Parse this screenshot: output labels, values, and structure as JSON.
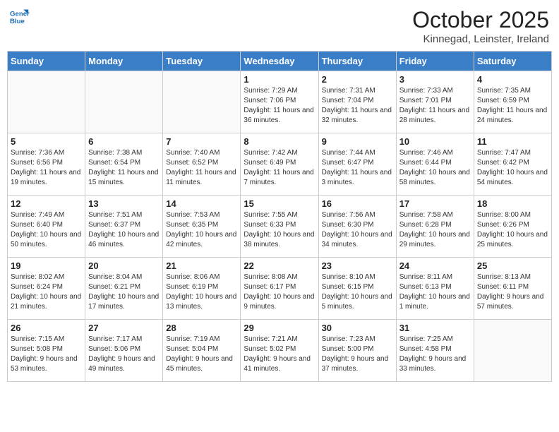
{
  "header": {
    "logo_line1": "General",
    "logo_line2": "Blue",
    "month": "October 2025",
    "location": "Kinnegad, Leinster, Ireland"
  },
  "weekdays": [
    "Sunday",
    "Monday",
    "Tuesday",
    "Wednesday",
    "Thursday",
    "Friday",
    "Saturday"
  ],
  "weeks": [
    [
      {
        "day": "",
        "content": ""
      },
      {
        "day": "",
        "content": ""
      },
      {
        "day": "",
        "content": ""
      },
      {
        "day": "1",
        "content": "Sunrise: 7:29 AM\nSunset: 7:06 PM\nDaylight: 11 hours\nand 36 minutes."
      },
      {
        "day": "2",
        "content": "Sunrise: 7:31 AM\nSunset: 7:04 PM\nDaylight: 11 hours\nand 32 minutes."
      },
      {
        "day": "3",
        "content": "Sunrise: 7:33 AM\nSunset: 7:01 PM\nDaylight: 11 hours\nand 28 minutes."
      },
      {
        "day": "4",
        "content": "Sunrise: 7:35 AM\nSunset: 6:59 PM\nDaylight: 11 hours\nand 24 minutes."
      }
    ],
    [
      {
        "day": "5",
        "content": "Sunrise: 7:36 AM\nSunset: 6:56 PM\nDaylight: 11 hours\nand 19 minutes."
      },
      {
        "day": "6",
        "content": "Sunrise: 7:38 AM\nSunset: 6:54 PM\nDaylight: 11 hours\nand 15 minutes."
      },
      {
        "day": "7",
        "content": "Sunrise: 7:40 AM\nSunset: 6:52 PM\nDaylight: 11 hours\nand 11 minutes."
      },
      {
        "day": "8",
        "content": "Sunrise: 7:42 AM\nSunset: 6:49 PM\nDaylight: 11 hours\nand 7 minutes."
      },
      {
        "day": "9",
        "content": "Sunrise: 7:44 AM\nSunset: 6:47 PM\nDaylight: 11 hours\nand 3 minutes."
      },
      {
        "day": "10",
        "content": "Sunrise: 7:46 AM\nSunset: 6:44 PM\nDaylight: 10 hours\nand 58 minutes."
      },
      {
        "day": "11",
        "content": "Sunrise: 7:47 AM\nSunset: 6:42 PM\nDaylight: 10 hours\nand 54 minutes."
      }
    ],
    [
      {
        "day": "12",
        "content": "Sunrise: 7:49 AM\nSunset: 6:40 PM\nDaylight: 10 hours\nand 50 minutes."
      },
      {
        "day": "13",
        "content": "Sunrise: 7:51 AM\nSunset: 6:37 PM\nDaylight: 10 hours\nand 46 minutes."
      },
      {
        "day": "14",
        "content": "Sunrise: 7:53 AM\nSunset: 6:35 PM\nDaylight: 10 hours\nand 42 minutes."
      },
      {
        "day": "15",
        "content": "Sunrise: 7:55 AM\nSunset: 6:33 PM\nDaylight: 10 hours\nand 38 minutes."
      },
      {
        "day": "16",
        "content": "Sunrise: 7:56 AM\nSunset: 6:30 PM\nDaylight: 10 hours\nand 34 minutes."
      },
      {
        "day": "17",
        "content": "Sunrise: 7:58 AM\nSunset: 6:28 PM\nDaylight: 10 hours\nand 29 minutes."
      },
      {
        "day": "18",
        "content": "Sunrise: 8:00 AM\nSunset: 6:26 PM\nDaylight: 10 hours\nand 25 minutes."
      }
    ],
    [
      {
        "day": "19",
        "content": "Sunrise: 8:02 AM\nSunset: 6:24 PM\nDaylight: 10 hours\nand 21 minutes."
      },
      {
        "day": "20",
        "content": "Sunrise: 8:04 AM\nSunset: 6:21 PM\nDaylight: 10 hours\nand 17 minutes."
      },
      {
        "day": "21",
        "content": "Sunrise: 8:06 AM\nSunset: 6:19 PM\nDaylight: 10 hours\nand 13 minutes."
      },
      {
        "day": "22",
        "content": "Sunrise: 8:08 AM\nSunset: 6:17 PM\nDaylight: 10 hours\nand 9 minutes."
      },
      {
        "day": "23",
        "content": "Sunrise: 8:10 AM\nSunset: 6:15 PM\nDaylight: 10 hours\nand 5 minutes."
      },
      {
        "day": "24",
        "content": "Sunrise: 8:11 AM\nSunset: 6:13 PM\nDaylight: 10 hours\nand 1 minute."
      },
      {
        "day": "25",
        "content": "Sunrise: 8:13 AM\nSunset: 6:11 PM\nDaylight: 9 hours\nand 57 minutes."
      }
    ],
    [
      {
        "day": "26",
        "content": "Sunrise: 7:15 AM\nSunset: 5:08 PM\nDaylight: 9 hours\nand 53 minutes."
      },
      {
        "day": "27",
        "content": "Sunrise: 7:17 AM\nSunset: 5:06 PM\nDaylight: 9 hours\nand 49 minutes."
      },
      {
        "day": "28",
        "content": "Sunrise: 7:19 AM\nSunset: 5:04 PM\nDaylight: 9 hours\nand 45 minutes."
      },
      {
        "day": "29",
        "content": "Sunrise: 7:21 AM\nSunset: 5:02 PM\nDaylight: 9 hours\nand 41 minutes."
      },
      {
        "day": "30",
        "content": "Sunrise: 7:23 AM\nSunset: 5:00 PM\nDaylight: 9 hours\nand 37 minutes."
      },
      {
        "day": "31",
        "content": "Sunrise: 7:25 AM\nSunset: 4:58 PM\nDaylight: 9 hours\nand 33 minutes."
      },
      {
        "day": "",
        "content": ""
      }
    ]
  ]
}
